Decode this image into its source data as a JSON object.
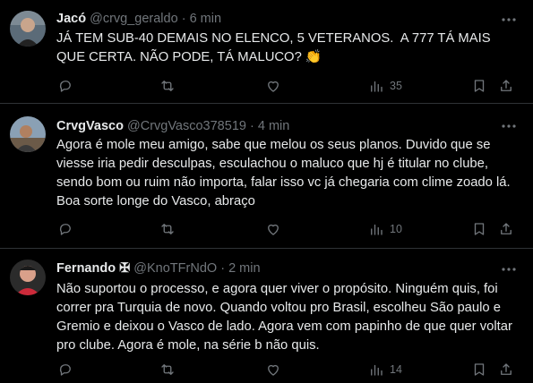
{
  "tweets": [
    {
      "name": "Jacó",
      "handle": "@crvg_geraldo",
      "sep": "·",
      "time": "6 min",
      "text": "JÁ TEM SUB-40 DEMAIS NO ELENCO, 5 VETERANOS.  A 777 TÁ MAIS QUE CERTA. NÃO PODE, TÁ MALUCO? 👏",
      "views": "35",
      "avatar_colors": {
        "bg": "#5b6b78",
        "face": "#c9a58c",
        "shirt": "#222"
      }
    },
    {
      "name": "CrvgVasco",
      "handle": "@CrvgVasco378519",
      "sep": "·",
      "time": "4 min",
      "text": "Agora é mole meu amigo, sabe que melou os seus planos. Duvido que se viesse iria pedir desculpas, esculachou o maluco que hj é titular no clube, sendo bom ou ruim não importa, falar isso vc já chegaria com clime zoado lá. Boa sorte longe do Vasco, abraço",
      "views": "10",
      "avatar_colors": {
        "bg": "#8aa0b4",
        "face": "#b08060",
        "shirt": "#3a3a3a"
      }
    },
    {
      "name": "Fernando",
      "name_badge": "✠",
      "handle": "@KnoTFrNdO",
      "sep": "·",
      "time": "2 min",
      "text": "Não suportou o processo, e agora quer viver o propósito. Ninguém quis, foi correr pra Turquia de novo. Quando voltou pro Brasil, escolheu São paulo e Gremio e deixou o Vasco de lado. Agora vem com papinho de que quer voltar pro clube. Agora é mole, na série b não quis.",
      "views": "14",
      "avatar_colors": {
        "bg": "#2b2b2b",
        "face": "#d9a08a",
        "shirt": "#cc2a3a"
      }
    }
  ],
  "icons": [
    "reply-icon",
    "retweet-icon",
    "like-icon",
    "views-icon",
    "bookmark-icon",
    "share-icon",
    "more-icon"
  ]
}
